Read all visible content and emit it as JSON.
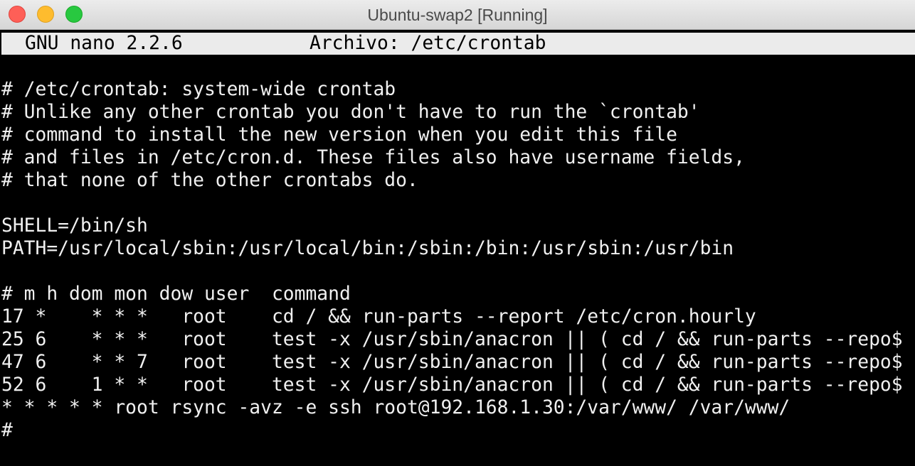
{
  "window": {
    "title": "Ubuntu-swap2 [Running]"
  },
  "nano": {
    "version": "GNU nano 2.2.6",
    "file_label": "Archivo: /etc/crontab"
  },
  "content": {
    "lines": [
      "# /etc/crontab: system-wide crontab",
      "# Unlike any other crontab you don't have to run the `crontab'",
      "# command to install the new version when you edit this file",
      "# and files in /etc/cron.d. These files also have username fields,",
      "# that none of the other crontabs do.",
      "",
      "SHELL=/bin/sh",
      "PATH=/usr/local/sbin:/usr/local/bin:/sbin:/bin:/usr/sbin:/usr/bin",
      "",
      "# m h dom mon dow user  command",
      "17 *    * * *   root    cd / && run-parts --report /etc/cron.hourly",
      "25 6    * * *   root    test -x /usr/sbin/anacron || ( cd / && run-parts --repo$",
      "47 6    * * 7   root    test -x /usr/sbin/anacron || ( cd / && run-parts --repo$",
      "52 6    1 * *   root    test -x /usr/sbin/anacron || ( cd / && run-parts --repo$",
      "* * * * * root rsync -avz -e ssh root@192.168.1.30:/var/www/ /var/www/",
      "#"
    ]
  }
}
